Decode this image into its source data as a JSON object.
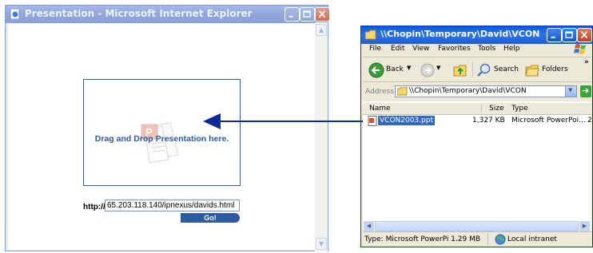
{
  "ie_window": {
    "title": "Presentation - Microsoft Internet Explorer",
    "drop_text": "Drag and Drop Presentation here.",
    "http_label": "http://",
    "url_value": "65.203.118.140/ipnexus/davids.html",
    "go_label": "Go!"
  },
  "explorer_window": {
    "title": "\\\\Chopin\\Temporary\\David\\VCON",
    "menu": [
      "File",
      "Edit",
      "View",
      "Favorites",
      "Tools",
      "Help"
    ],
    "menu_overflow": "»",
    "toolbar": {
      "back": "Back",
      "search": "Search",
      "folders": "Folders"
    },
    "address_label": "Address",
    "address_value": "\\\\Chopin\\Temporary\\David\\VCON",
    "go_label": "Go",
    "columns": {
      "name": "Name",
      "size": "Size",
      "type": "Type"
    },
    "files": [
      {
        "name": "VCON2003.ppt",
        "size": "1,327 KB",
        "type": "Microsoft PowerPoi...",
        "extra": "2"
      }
    ],
    "status": {
      "left": "Type: Microsoft PowerPi 1.29 MB",
      "zone": "Local intranet"
    }
  },
  "colors": {
    "accent": "#2c5aa0",
    "selection": "#316ac5",
    "arrow": "#0a2a9a"
  }
}
